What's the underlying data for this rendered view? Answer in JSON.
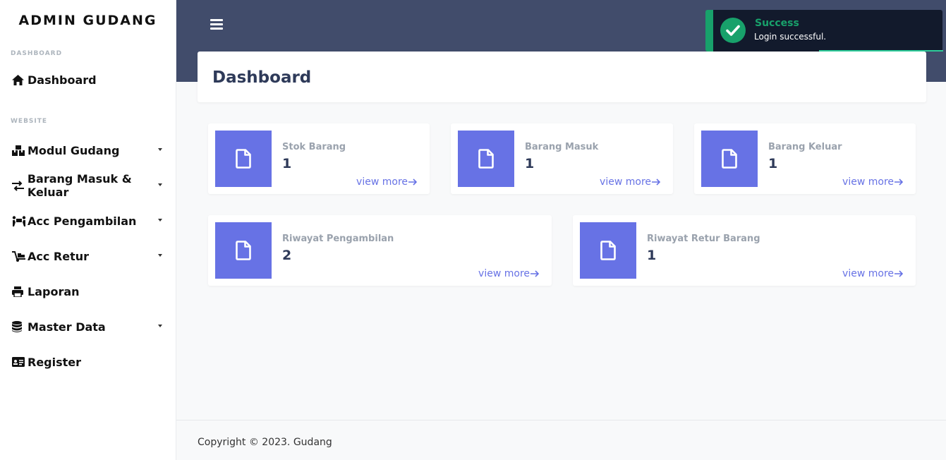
{
  "app": {
    "brand": "ADMIN GUDANG"
  },
  "sidebar": {
    "section_dashboard": "DASHBOARD",
    "section_website": "WEBSITE",
    "items": [
      {
        "label": "Dashboard",
        "icon": "home-icon"
      },
      {
        "label": "Modul Gudang",
        "icon": "boxes-icon",
        "has_dropdown": true
      },
      {
        "label": "Barang Masuk & Keluar",
        "icon": "exchange-icon",
        "has_dropdown": true
      },
      {
        "label": "Acc Pengambilan",
        "icon": "people-carry-icon",
        "has_dropdown": true
      },
      {
        "label": "Acc Retur",
        "icon": "dolly-icon",
        "has_dropdown": true
      },
      {
        "label": "Laporan",
        "icon": "print-icon"
      },
      {
        "label": "Master Data",
        "icon": "database-icon",
        "has_dropdown": true
      },
      {
        "label": "Register",
        "icon": "id-card-icon"
      }
    ]
  },
  "header": {
    "menu_icon": "hamburger-icon"
  },
  "page": {
    "title": "Dashboard"
  },
  "cards": [
    {
      "label": "Stok Barang",
      "value": "1",
      "link": "view more"
    },
    {
      "label": "Barang Masuk",
      "value": "1",
      "link": "view more"
    },
    {
      "label": "Barang Keluar",
      "value": "1",
      "link": "view more"
    },
    {
      "label": "Riwayat Pengambilan",
      "value": "2",
      "link": "view more"
    },
    {
      "label": "Riwayat Retur Barang",
      "value": "1",
      "link": "view more"
    }
  ],
  "footer": {
    "text": "Copyright © 2023. Gudang"
  },
  "toast": {
    "title": "Success",
    "message": "Login successful."
  },
  "colors": {
    "accent": "#6772e5",
    "header": "#414c6b",
    "success": "#18a16b",
    "toast_bg": "#121a2c"
  }
}
